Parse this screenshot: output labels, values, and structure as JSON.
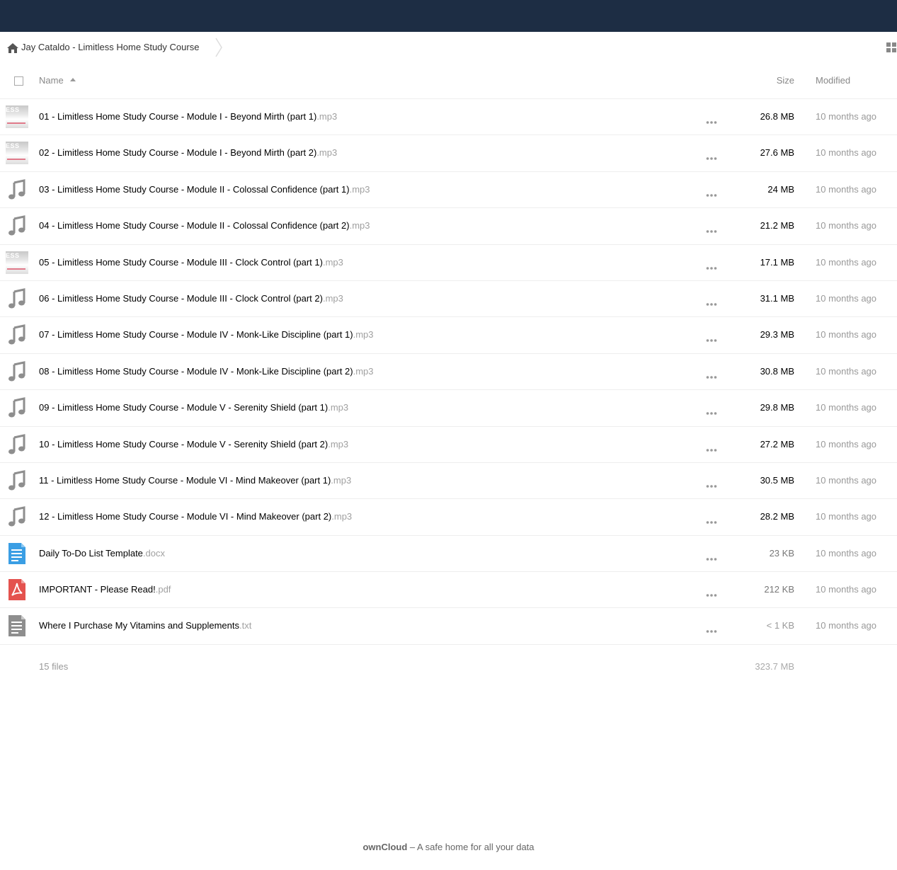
{
  "breadcrumb": {
    "home_icon": "home-icon",
    "folder_label": "Jay Cataldo - Limitless Home Study Course"
  },
  "table": {
    "header": {
      "name": "Name",
      "size": "Size",
      "modified": "Modified"
    },
    "files": [
      {
        "base": "01 - Limitless Home Study Course - Module I - Beyond Mirth (part 1)",
        "ext": ".mp3",
        "icon": "thumbnail",
        "size": "26.8 MB",
        "modified": "10 months ago",
        "size_color": "#000000"
      },
      {
        "base": "02 - Limitless Home Study Course - Module I - Beyond Mirth (part 2)",
        "ext": ".mp3",
        "icon": "thumbnail",
        "size": "27.6 MB",
        "modified": "10 months ago",
        "size_color": "#000000"
      },
      {
        "base": "03 - Limitless Home Study Course - Module II - Colossal Confidence (part 1)",
        "ext": ".mp3",
        "icon": "music-note-icon",
        "size": "24 MB",
        "modified": "10 months ago",
        "size_color": "#000000"
      },
      {
        "base": "04 - Limitless Home Study Course - Module II - Colossal Confidence (part 2)",
        "ext": ".mp3",
        "icon": "music-note-icon",
        "size": "21.2 MB",
        "modified": "10 months ago",
        "size_color": "#000000"
      },
      {
        "base": "05 - Limitless Home Study Course - Module III - Clock Control (part 1)",
        "ext": ".mp3",
        "icon": "thumbnail",
        "size": "17.1 MB",
        "modified": "10 months ago",
        "size_color": "#000000"
      },
      {
        "base": "06 - Limitless Home Study Course - Module III - Clock Control (part 2)",
        "ext": ".mp3",
        "icon": "music-note-icon",
        "size": "31.1 MB",
        "modified": "10 months ago",
        "size_color": "#000000"
      },
      {
        "base": "07 - Limitless Home Study Course - Module IV - Monk-Like Discipline (part 1)",
        "ext": ".mp3",
        "icon": "music-note-icon",
        "size": "29.3 MB",
        "modified": "10 months ago",
        "size_color": "#000000"
      },
      {
        "base": "08 - Limitless Home Study Course - Module IV - Monk-Like Discipline (part 2)",
        "ext": ".mp3",
        "icon": "music-note-icon",
        "size": "30.8 MB",
        "modified": "10 months ago",
        "size_color": "#000000"
      },
      {
        "base": "09 - Limitless Home Study Course - Module V - Serenity Shield (part 1)",
        "ext": ".mp3",
        "icon": "music-note-icon",
        "size": "29.8 MB",
        "modified": "10 months ago",
        "size_color": "#000000"
      },
      {
        "base": "10 - Limitless Home Study Course - Module V - Serenity Shield (part 2)",
        "ext": ".mp3",
        "icon": "music-note-icon",
        "size": "27.2 MB",
        "modified": "10 months ago",
        "size_color": "#000000"
      },
      {
        "base": "11 - Limitless Home Study Course - Module VI - Mind Makeover (part 1)",
        "ext": ".mp3",
        "icon": "music-note-icon",
        "size": "30.5 MB",
        "modified": "10 months ago",
        "size_color": "#000000"
      },
      {
        "base": "12 - Limitless Home Study Course - Module VI - Mind Makeover (part 2)",
        "ext": ".mp3",
        "icon": "music-note-icon",
        "size": "28.2 MB",
        "modified": "10 months ago",
        "size_color": "#000000"
      },
      {
        "base": "Daily To-Do List Template",
        "ext": ".docx",
        "icon": "document-icon",
        "size": "23 KB",
        "modified": "10 months ago",
        "size_color": "#777777"
      },
      {
        "base": "IMPORTANT - Please Read!",
        "ext": ".pdf",
        "icon": "pdf-icon",
        "size": "212 KB",
        "modified": "10 months ago",
        "size_color": "#777777"
      },
      {
        "base": "Where I Purchase My Vitamins and Supplements",
        "ext": ".txt",
        "icon": "text-file-icon",
        "size": "< 1 KB",
        "modified": "10 months ago",
        "size_color": "#999999"
      }
    ],
    "thumbnail_text": "ESS",
    "summary": {
      "count": "15 files",
      "total_size": "323.7 MB"
    }
  },
  "footer": {
    "brand": "ownCloud",
    "tagline": " – A safe home for all your data"
  },
  "colors": {
    "topbar": "#1d2d44",
    "music_icon": "#8e8e8e",
    "document_icon": "#3a9ee4",
    "pdf_icon": "#e4524e",
    "text_icon": "#8e8e8e"
  }
}
